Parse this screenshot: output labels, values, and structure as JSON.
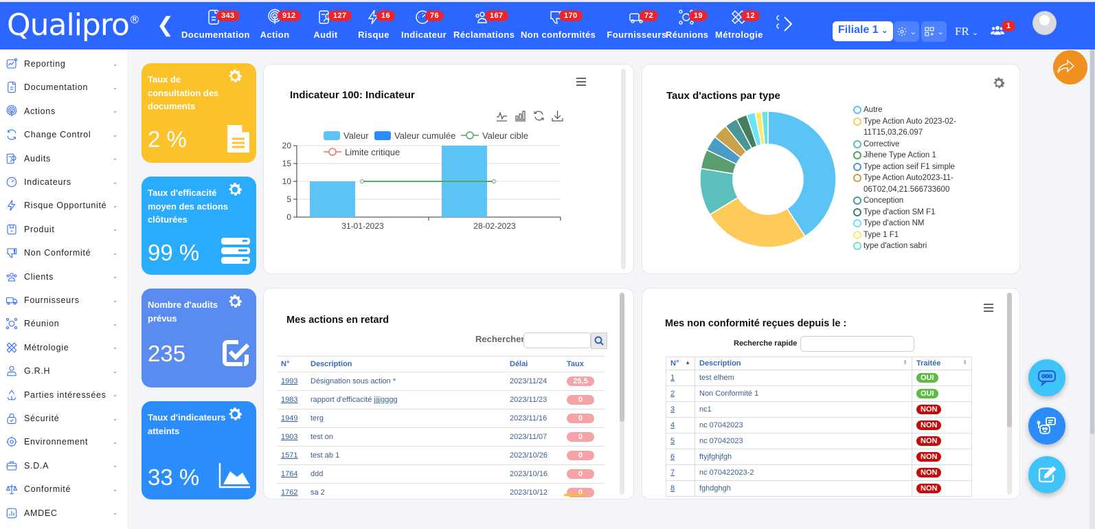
{
  "header": {
    "logo": "Qualipro",
    "logo_mark": "®",
    "nav": [
      {
        "label": "Documentation",
        "count": "343",
        "icon": "document-icon"
      },
      {
        "label": "Action",
        "count": "912",
        "icon": "fingerprint-icon"
      },
      {
        "label": "Audit",
        "count": "127",
        "icon": "audit-icon"
      },
      {
        "label": "Risque",
        "count": "16",
        "icon": "lightning-icon"
      },
      {
        "label": "Indicateur",
        "count": "76",
        "icon": "gauge-icon"
      },
      {
        "label": "Réclamations",
        "count": "167",
        "icon": "users-icon"
      },
      {
        "label": "Non conformités",
        "count": "170",
        "icon": "thumbs-down-icon"
      },
      {
        "label": "Fournisseurs",
        "count": "72",
        "icon": "truck-icon"
      },
      {
        "label": "Réunions",
        "count": "19",
        "icon": "meeting-icon"
      },
      {
        "label": "Métrologie",
        "count": "12",
        "icon": "ruler-pencil-icon"
      }
    ],
    "filiale": "Filiale 1",
    "lang": "FR",
    "notif_count": "1"
  },
  "sidebar": {
    "items": [
      {
        "label": "Reporting"
      },
      {
        "label": "Documentation"
      },
      {
        "label": "Actions"
      },
      {
        "label": "Change Control"
      },
      {
        "label": "Audits"
      },
      {
        "label": "Indicateurs"
      },
      {
        "label": "Risque Opportunité"
      },
      {
        "label": "Produit"
      },
      {
        "label": "Non Conformité"
      },
      {
        "label": "Clients"
      },
      {
        "label": "Fournisseurs"
      },
      {
        "label": "Réunion"
      },
      {
        "label": "Métrologie"
      },
      {
        "label": "G.R.H"
      },
      {
        "label": "Parties intéressées"
      },
      {
        "label": "Sécurité"
      },
      {
        "label": "Environnement"
      },
      {
        "label": "S.D.A"
      },
      {
        "label": "Conformité"
      },
      {
        "label": "AMDEC"
      }
    ]
  },
  "kpis": [
    {
      "title": "Taux de consultation des documents",
      "value": "2 %",
      "color": "#fcc22a",
      "icon": "document-icon"
    },
    {
      "title": "Taux d'efficacité moyen des actions clôturées",
      "value": "99 %",
      "color": "#2aabfc",
      "icon": "server-icon"
    },
    {
      "title": "Nombre d'audits prévus",
      "value": "235",
      "color": "#5a8cf0",
      "icon": "checkbox-icon"
    },
    {
      "title": "Taux d'indicateurs atteints",
      "value": "33 %",
      "color": "#2b8cfc",
      "icon": "area-chart-icon"
    }
  ],
  "chart_data": [
    {
      "type": "bar",
      "title": "Indicateur 100: Indicateur",
      "categories": [
        "31-01-2023",
        "28-02-2023"
      ],
      "series": [
        {
          "name": "Valeur",
          "type": "bar",
          "color": "#5bc4f5",
          "values": [
            10,
            20
          ]
        },
        {
          "name": "Valeur cumulée",
          "type": "bar",
          "color": "#2b8cf7",
          "values": [
            null,
            null
          ]
        },
        {
          "name": "Valeur cible",
          "type": "line",
          "color": "#5aa469",
          "values": [
            10,
            10
          ]
        },
        {
          "name": "Limite critique",
          "type": "line",
          "color": "#f0735f",
          "values": [
            null,
            null
          ]
        }
      ],
      "ylim": [
        0,
        20
      ],
      "yticks": [
        0,
        5,
        10,
        15,
        20
      ],
      "grid": true,
      "legend": "top"
    },
    {
      "type": "pie",
      "title": "Taux d'actions par type",
      "labels": [
        "Autre",
        "Type Action Auto 2023-02-11T15,03,26.097",
        "Corrective",
        "Jihene Type Action 1",
        "Type action seif F1 simple",
        "Type Action Auto2023-11-06T02,04,21.566733600",
        "Conception",
        "Type d'action SM F1",
        "Type d'action NM",
        "Type 1 F1",
        "type d'action sabri"
      ],
      "values": [
        40,
        25,
        11,
        4.5,
        3.5,
        3.5,
        3,
        2.5,
        2,
        1.5,
        1.5
      ],
      "colors": [
        "#5bc4f5",
        "#fecb5b",
        "#5bbfbd",
        "#5a9e70",
        "#4a9cc7",
        "#c9a24a",
        "#4a9595",
        "#457e5e",
        "#6be3fb",
        "#fde96d",
        "#6be0e0"
      ],
      "legend": "right"
    }
  ],
  "actions_panel": {
    "title": "Mes actions en retard",
    "search_label": "Rechercher",
    "columns": [
      "N°",
      "Description",
      "Délai",
      "Taux"
    ],
    "rows": [
      {
        "id": "1993",
        "desc": "Désignation sous action *",
        "delai": "2023/11/24",
        "taux": "25,5"
      },
      {
        "id": "1983",
        "desc": "rapport d'efficacité jjjjgggg",
        "delai": "2023/11/23",
        "taux": "0"
      },
      {
        "id": "1949",
        "desc": "terg",
        "delai": "2023/11/16",
        "taux": "0"
      },
      {
        "id": "1903",
        "desc": "test on",
        "delai": "2023/11/07",
        "taux": "0"
      },
      {
        "id": "1571",
        "desc": "test ab 1",
        "delai": "2023/10/26",
        "taux": "0"
      },
      {
        "id": "1764",
        "desc": "ddd",
        "delai": "2023/10/16",
        "taux": "0"
      },
      {
        "id": "1762",
        "desc": "sa 2",
        "delai": "2023/10/12",
        "taux": "0"
      }
    ]
  },
  "nc_panel": {
    "title": "Mes non conformité reçues depuis le :",
    "search_label": "Recherche rapide",
    "columns": [
      "N°",
      "Description",
      "Traitée"
    ],
    "rows": [
      {
        "id": "1",
        "desc": "test elhem",
        "traitee": "OUI"
      },
      {
        "id": "2",
        "desc": "Non Conformité 1",
        "traitee": "OUI"
      },
      {
        "id": "3",
        "desc": "nc1",
        "traitee": "NON"
      },
      {
        "id": "4",
        "desc": "nc 07042023",
        "traitee": "NON"
      },
      {
        "id": "5",
        "desc": "nc 07042023",
        "traitee": "NON"
      },
      {
        "id": "6",
        "desc": "ftyjfghjfgh",
        "traitee": "NON"
      },
      {
        "id": "7",
        "desc": "nc 070422023-2",
        "traitee": "NON"
      },
      {
        "id": "8",
        "desc": "fghdghgh",
        "traitee": "NON"
      }
    ]
  }
}
